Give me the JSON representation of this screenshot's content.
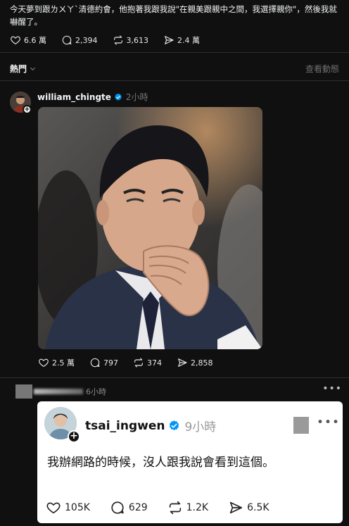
{
  "post1": {
    "text": "今天夢到跟ㄌㄨㄚˋ清德約會，他抱著我跟我說\"在親美跟親中之間，我選擇親你\"，然後我就嚇醒了。",
    "likes": "6.6 萬",
    "replies": "2,394",
    "reposts": "3,613",
    "shares": "2.4 萬"
  },
  "tabs": {
    "hot": "熱門",
    "view_activity": "查看動態"
  },
  "post2": {
    "username": "william_chingte",
    "time": "2小時",
    "likes": "2.5 萬",
    "replies": "797",
    "reposts": "374",
    "shares": "2,858"
  },
  "post3": {
    "time": "6小時",
    "card": {
      "username": "tsai_ingwen",
      "time": "9小時",
      "text": "我辦網路的時候，沒人跟我說會看到這個。",
      "likes": "105K",
      "replies": "629",
      "reposts": "1.2K",
      "shares": "6.5K"
    }
  },
  "colors": {
    "background": "#101010",
    "text": "#f3f5f7",
    "muted": "#777777",
    "verified": "#0095f6"
  },
  "icons": [
    "heart-icon",
    "comment-icon",
    "repost-icon",
    "share-icon",
    "chevron-down-icon",
    "verified-badge-icon",
    "follow-plus-icon",
    "more-icon"
  ]
}
